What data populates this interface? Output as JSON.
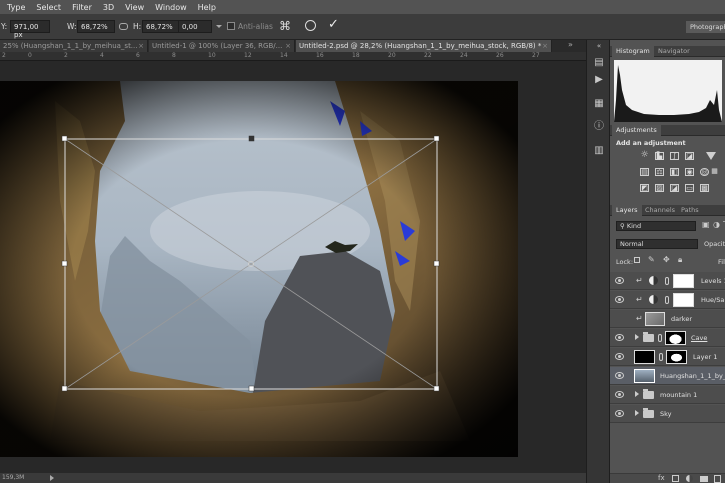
{
  "menu": [
    "Type",
    "Select",
    "Filter",
    "3D",
    "View",
    "Window",
    "Help"
  ],
  "options": {
    "y_label": "Y:",
    "y_value": "971,00 px",
    "w_label": "W:",
    "w_value": "68,72%",
    "h_label": "H:",
    "h_value": "68,72%",
    "angle_value": "0,00",
    "antialias_label": "Anti-alias",
    "workspace_label": "Photograph"
  },
  "tabs": [
    {
      "label": "25% (Huangshan_1_1_by_meihua_st...",
      "active": false
    },
    {
      "label": "Untitled-1 @ 100% (Layer 36, RGB/...",
      "active": false
    },
    {
      "label": "Untitled-2.psd @ 28,2% (Huangshan_1_1_by_meihua_stock, RGB/8) *",
      "active": true
    }
  ],
  "ruler_ticks": [
    "2",
    "0",
    "2",
    "4",
    "6",
    "8",
    "10",
    "12",
    "14",
    "16",
    "18",
    "20",
    "22",
    "24",
    "26",
    "27"
  ],
  "status": {
    "zoom": "159,3M"
  },
  "panels": {
    "histogram_tabs": [
      "Histogram",
      "Navigator"
    ],
    "adjust_tabs": [
      "Adjustments"
    ],
    "adjust_title": "Add an adjustment",
    "layers_tabs": [
      "Layers",
      "Channels",
      "Paths"
    ],
    "kind_label": "Kind",
    "blend_mode": "Normal",
    "opacity_label": "Opacit",
    "lock_label": "Lock:",
    "fill_label": "Fil",
    "layers": [
      {
        "name": "Levels 1",
        "type": "adjust",
        "selected": false
      },
      {
        "name": "Hue/Sa",
        "type": "adjust",
        "selected": false
      },
      {
        "name": "darker",
        "type": "pixel",
        "selected": false
      },
      {
        "name": "Cave",
        "type": "group",
        "selected": false
      },
      {
        "name": "Layer 1",
        "type": "mask",
        "selected": false
      },
      {
        "name": "Huangshan_1_1_by_",
        "type": "smart",
        "selected": true
      },
      {
        "name": "mountain 1",
        "type": "group",
        "selected": false
      },
      {
        "name": "Sky",
        "type": "group",
        "selected": false
      }
    ]
  }
}
